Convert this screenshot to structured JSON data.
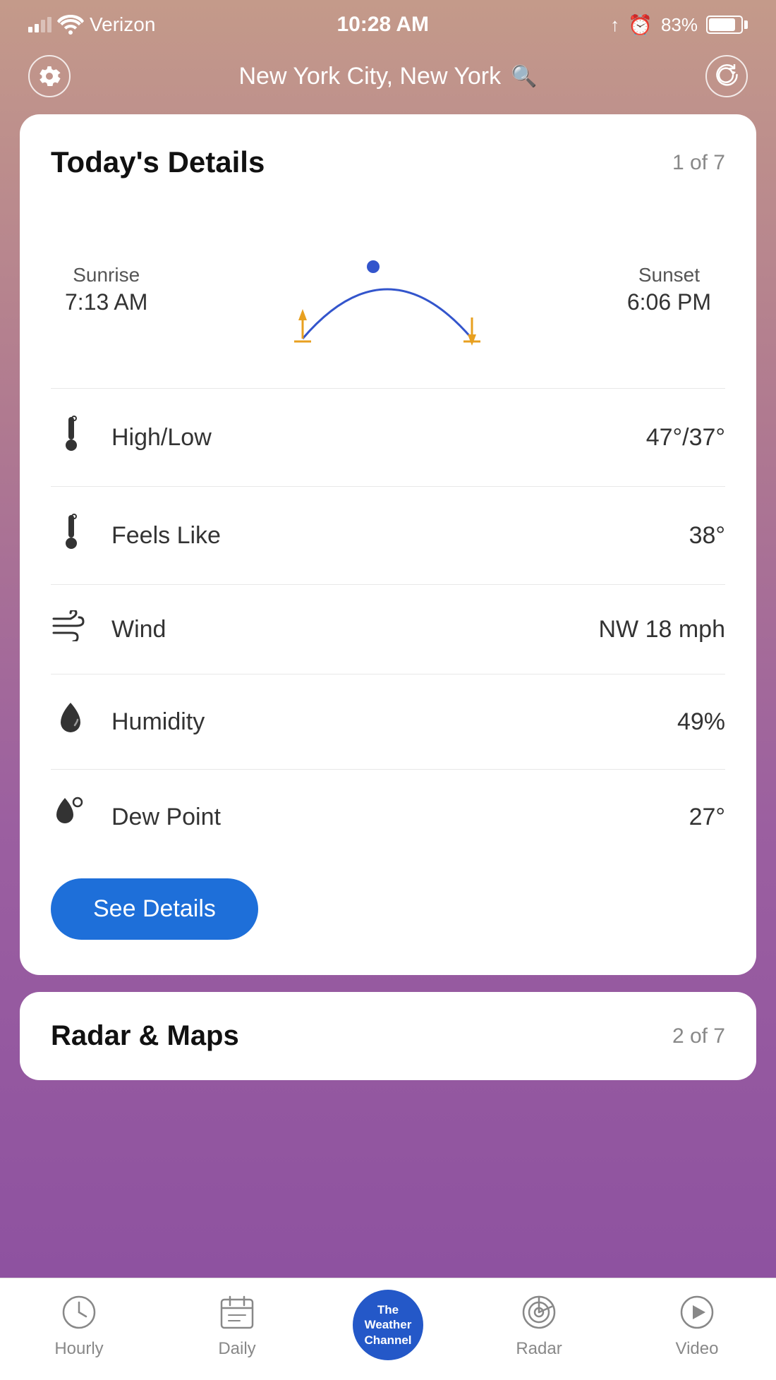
{
  "statusBar": {
    "carrier": "Verizon",
    "time": "10:28 AM",
    "battery": "83%"
  },
  "header": {
    "location": "New York City, New York",
    "settings_label": "settings",
    "refresh_label": "refresh"
  },
  "todaysDetails": {
    "title": "Today's Details",
    "pagination": "1 of 7",
    "sunrise_label": "Sunrise",
    "sunrise_time": "7:13 AM",
    "sunset_label": "Sunset",
    "sunset_time": "6:06 PM",
    "rows": [
      {
        "icon": "thermometer-high-low",
        "label": "High/Low",
        "value": "47°/37°"
      },
      {
        "icon": "thermometer-feels-like",
        "label": "Feels Like",
        "value": "38°"
      },
      {
        "icon": "wind",
        "label": "Wind",
        "value": "NW 18 mph"
      },
      {
        "icon": "humidity",
        "label": "Humidity",
        "value": "49%"
      },
      {
        "icon": "dew-point",
        "label": "Dew Point",
        "value": "27°"
      }
    ],
    "see_details_btn": "See Details"
  },
  "radarCard": {
    "title": "Radar & Maps",
    "pagination": "2 of 7"
  },
  "bottomNav": {
    "items": [
      {
        "label": "Hourly",
        "icon": "clock"
      },
      {
        "label": "Daily",
        "icon": "calendar"
      },
      {
        "label": "The Weather Channel",
        "icon": "twc-logo"
      },
      {
        "label": "Radar",
        "icon": "radar"
      },
      {
        "label": "Video",
        "icon": "play"
      }
    ]
  }
}
